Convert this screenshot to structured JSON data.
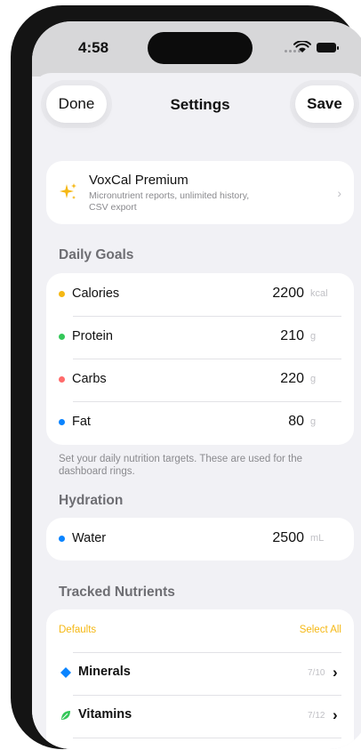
{
  "status_bar": {
    "time": "4:58"
  },
  "nav": {
    "done_label": "Done",
    "title": "Settings",
    "save_label": "Save"
  },
  "premium": {
    "icon": "sparkles-icon",
    "title": "VoxCal Premium",
    "subtitle_line1": "Micronutrient reports, unlimited history,",
    "subtitle_line2": "CSV export",
    "chevron": "›"
  },
  "daily_goals": {
    "header": "Daily Goals",
    "items": [
      {
        "name": "Calories",
        "value": "2200",
        "unit": "kcal",
        "color": "#f5b814"
      },
      {
        "name": "Protein",
        "value": "210",
        "unit": "g",
        "color": "#34c759"
      },
      {
        "name": "Carbs",
        "value": "220",
        "unit": "g",
        "color": "#ff6b6b"
      },
      {
        "name": "Fat",
        "value": "80",
        "unit": "g",
        "color": "#0a84ff"
      }
    ],
    "note": "Set your daily nutrition targets. These are used for the dashboard rings."
  },
  "hydration": {
    "header": "Hydration",
    "item": {
      "name": "Water",
      "value": "2500",
      "unit": "mL",
      "color": "#0a84ff"
    }
  },
  "tracked_nutrients": {
    "header": "Tracked Nutrients",
    "defaults_label": "Defaults",
    "select_all_label": "Select All",
    "accent": "#f5b814",
    "groups": [
      {
        "name": "Minerals",
        "count": "7/10",
        "icon": "diamond-icon",
        "color": "#0a84ff"
      },
      {
        "name": "Vitamins",
        "count": "7/12",
        "icon": "leaf-icon",
        "color": "#34c759"
      }
    ]
  }
}
